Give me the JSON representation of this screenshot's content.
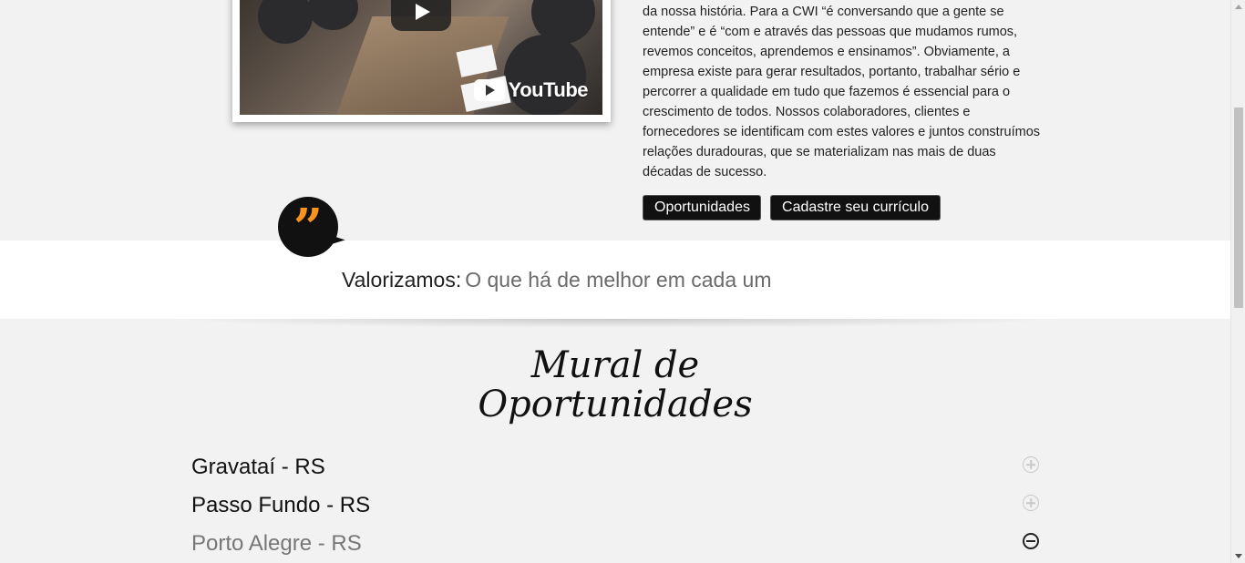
{
  "video": {
    "logo_text": "YouTube"
  },
  "about": {
    "paragraph": "da nossa história. Para a CWI “é conversando que a gente se entende” e é “com e através das pessoas que mudamos rumos, revemos conceitos, aprendemos e ensinamos”. Obviamente, a empresa existe para gerar resultados, portanto, trabalhar sério e percorrer a qualidade em tudo que fazemos é essencial para o crescimento de todos. Nossos colaboradores, clientes e fornecedores se identificam com estes valores e juntos construímos relações duradouras, que se materializam nas mais de duas décadas de sucesso.",
    "buttons": {
      "opportunities": "Oportunidades",
      "register_cv": "Cadastre seu currículo"
    }
  },
  "quote": {
    "mark": "”",
    "lead": "Valorizamos:",
    "text": "O que há de melhor em cada um",
    "accent_color": "#f7931e"
  },
  "mural": {
    "title": "Mural de Oportunidades",
    "locations": [
      {
        "name": "Gravataí - RS",
        "state": "collapsed",
        "icon": "plus-circle-icon"
      },
      {
        "name": "Passo Fundo - RS",
        "state": "collapsed",
        "icon": "plus-circle-icon"
      },
      {
        "name": "Porto Alegre - RS",
        "state": "expanded",
        "icon": "minus-circle-icon"
      }
    ]
  }
}
